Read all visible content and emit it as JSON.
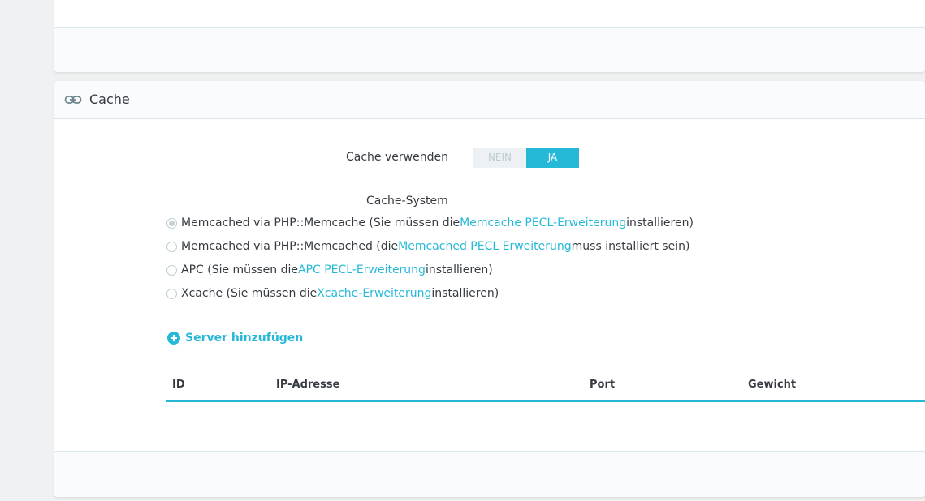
{
  "panel": {
    "title": "Cache",
    "icon": "link-icon"
  },
  "use_cache": {
    "label": "Cache verwenden",
    "options": [
      "NEIN",
      "JA"
    ],
    "selected": "JA"
  },
  "cache_system": {
    "label": "Cache-System",
    "options": [
      {
        "before": "Memcached via PHP::Memcache (Sie müssen die ",
        "link": "Memcache PECL-Erweiterung",
        "after": " installieren)",
        "checked": true
      },
      {
        "before": "Memcached via PHP::Memcached (die ",
        "link": "Memcached PECL Erweiterung",
        "after": " muss installiert sein)",
        "checked": false
      },
      {
        "before": "APC (Sie müssen die ",
        "link": "APC PECL-Erweiterung",
        "after": " installieren)",
        "checked": false
      },
      {
        "before": "Xcache (Sie müssen die ",
        "link": "Xcache-Erweiterung",
        "after": " installieren)",
        "checked": false
      }
    ]
  },
  "add_server": {
    "label": "Server hinzufügen",
    "icon": "plus-circle-icon"
  },
  "server_table": {
    "columns": [
      "ID",
      "IP-Adresse",
      "Port",
      "Gewicht"
    ]
  },
  "colors": {
    "accent": "#25b9d7",
    "text": "#363a41",
    "background": "#eff1f2"
  }
}
